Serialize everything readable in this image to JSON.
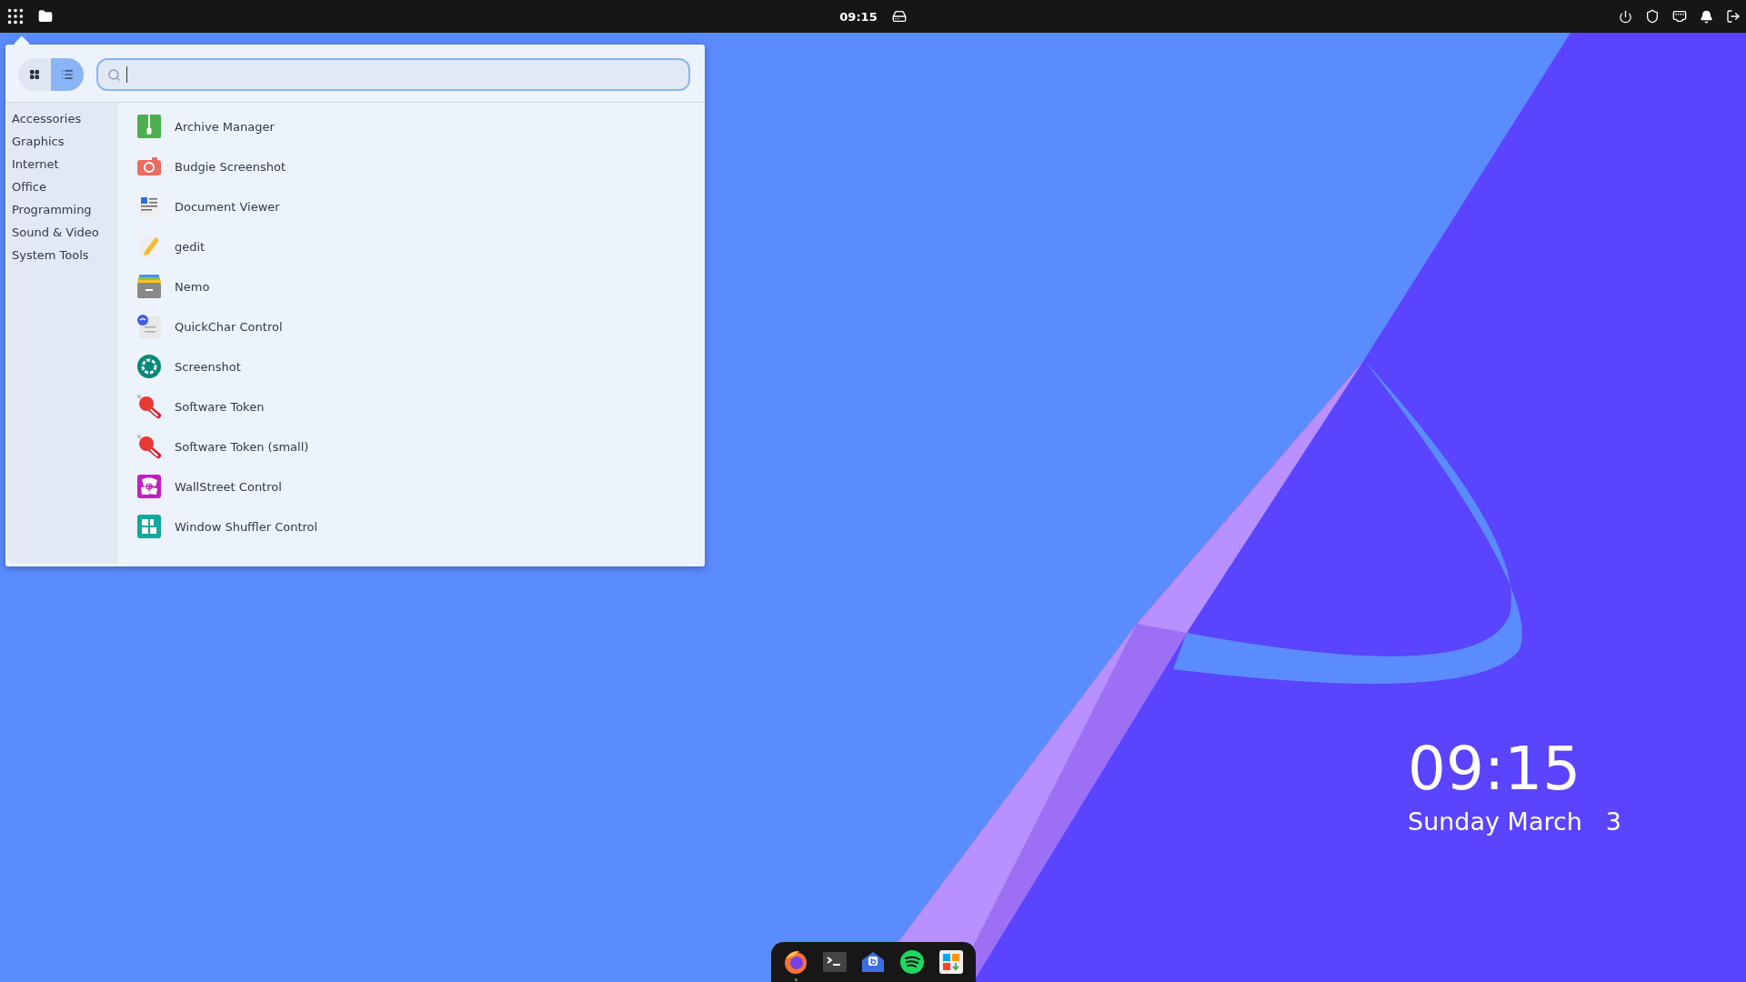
{
  "top_bar": {
    "clock": "09:15"
  },
  "menu": {
    "view_buttons": [
      {
        "kind": "grid",
        "selected": false
      },
      {
        "kind": "list",
        "selected": true
      }
    ],
    "categories": [
      "Accessories",
      "Graphics",
      "Internet",
      "Office",
      "Programming",
      "Sound & Video",
      "System Tools"
    ],
    "apps": [
      {
        "name": "Archive Manager",
        "kind": "archive"
      },
      {
        "name": "Budgie Screenshot",
        "kind": "camera"
      },
      {
        "name": "Document Viewer",
        "kind": "document"
      },
      {
        "name": "gedit",
        "kind": "editor"
      },
      {
        "name": "Nemo",
        "kind": "files"
      },
      {
        "name": "QuickChar Control",
        "kind": "quickchar"
      },
      {
        "name": "Screenshot",
        "kind": "shutter"
      },
      {
        "name": "Software Token",
        "kind": "token"
      },
      {
        "name": "Software Token (small)",
        "kind": "token"
      },
      {
        "name": "WallStreet Control",
        "kind": "wallpaper"
      },
      {
        "name": "Window Shuffler Control",
        "kind": "shuffler"
      }
    ]
  },
  "desktop_clock": {
    "time": "09:15",
    "date": "Sunday March   3"
  },
  "dock": [
    {
      "kind": "browser",
      "running": true
    },
    {
      "kind": "terminal",
      "running": false
    },
    {
      "kind": "mail",
      "running": false
    },
    {
      "kind": "music",
      "running": false
    },
    {
      "kind": "store",
      "running": false
    }
  ]
}
